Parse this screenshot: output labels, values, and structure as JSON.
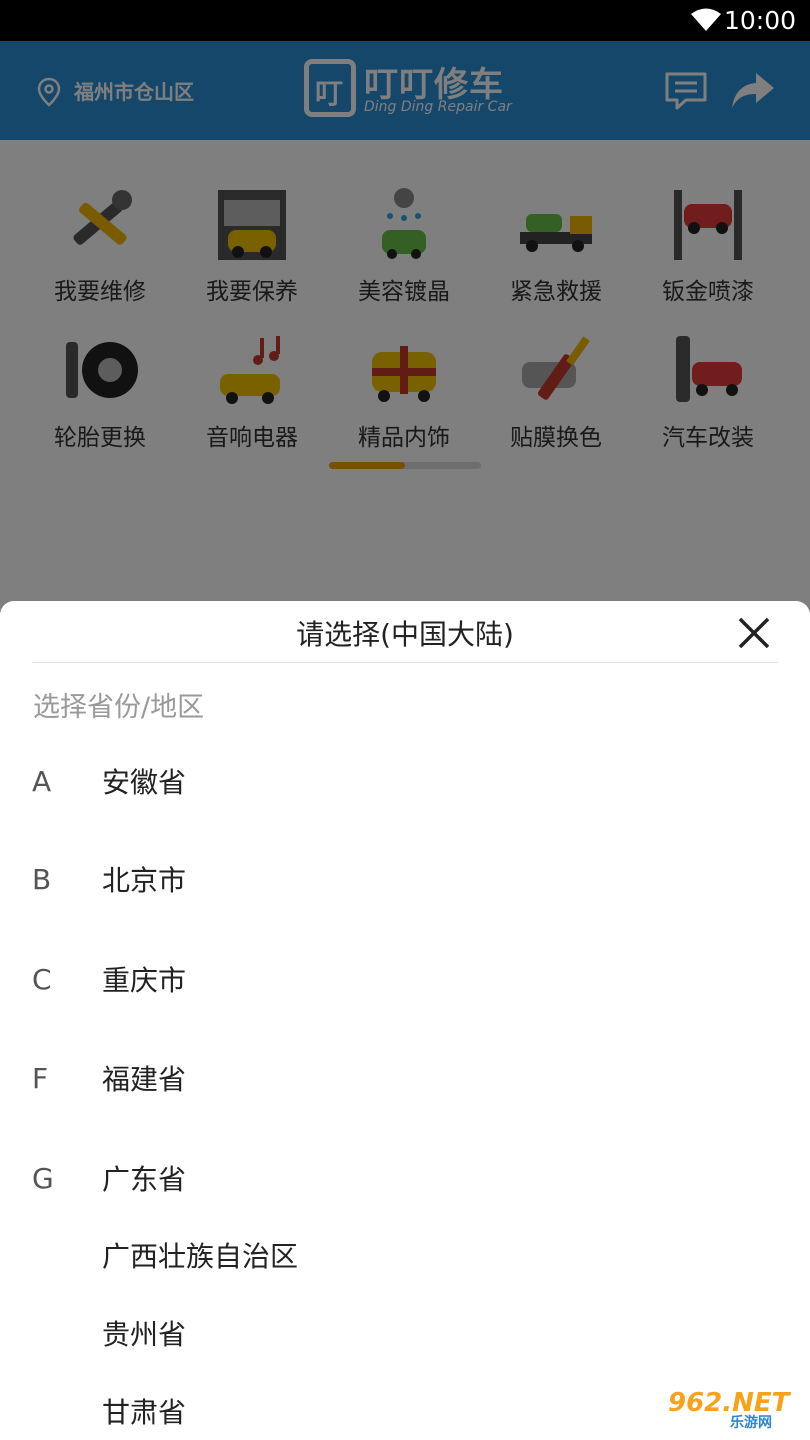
{
  "status_bar": {
    "time": "10:00"
  },
  "header": {
    "location": "福州市仓山区",
    "logo_mark": "叮",
    "logo_name": "叮叮修车",
    "logo_subtitle": "Ding Ding Repair Car"
  },
  "categories": [
    {
      "label": "我要维修",
      "icon": "wrench-hammer-icon"
    },
    {
      "label": "我要保养",
      "icon": "garage-car-icon"
    },
    {
      "label": "美容镀晶",
      "icon": "car-wash-icon"
    },
    {
      "label": "紧急救援",
      "icon": "tow-truck-icon"
    },
    {
      "label": "钣金喷漆",
      "icon": "car-lift-icon"
    },
    {
      "label": "轮胎更换",
      "icon": "tire-icon"
    },
    {
      "label": "音响电器",
      "icon": "car-music-icon"
    },
    {
      "label": "精品内饰",
      "icon": "car-gift-icon"
    },
    {
      "label": "贴膜换色",
      "icon": "car-paintbrush-icon"
    },
    {
      "label": "汽车改装",
      "icon": "car-modify-icon"
    }
  ],
  "page_indicator": {
    "active_fraction": 0.5
  },
  "sheet": {
    "title": "请选择(中国大陆)",
    "placeholder": "选择省份/地区",
    "items": [
      {
        "letter": "A",
        "name": "安徽省"
      },
      {
        "letter": "B",
        "name": "北京市"
      },
      {
        "letter": "C",
        "name": "重庆市"
      },
      {
        "letter": "F",
        "name": "福建省"
      },
      {
        "letter": "G",
        "name": "广东省"
      },
      {
        "letter": "",
        "name": "广西壮族自治区"
      },
      {
        "letter": "",
        "name": "贵州省"
      },
      {
        "letter": "",
        "name": "甘肃省"
      }
    ]
  },
  "watermark": {
    "main": "962.NET",
    "sub": "乐游网"
  },
  "colors": {
    "header": "#2a8fd6",
    "indicator": "#f0a000",
    "overlay": "rgba(0,0,0,0.5)"
  }
}
